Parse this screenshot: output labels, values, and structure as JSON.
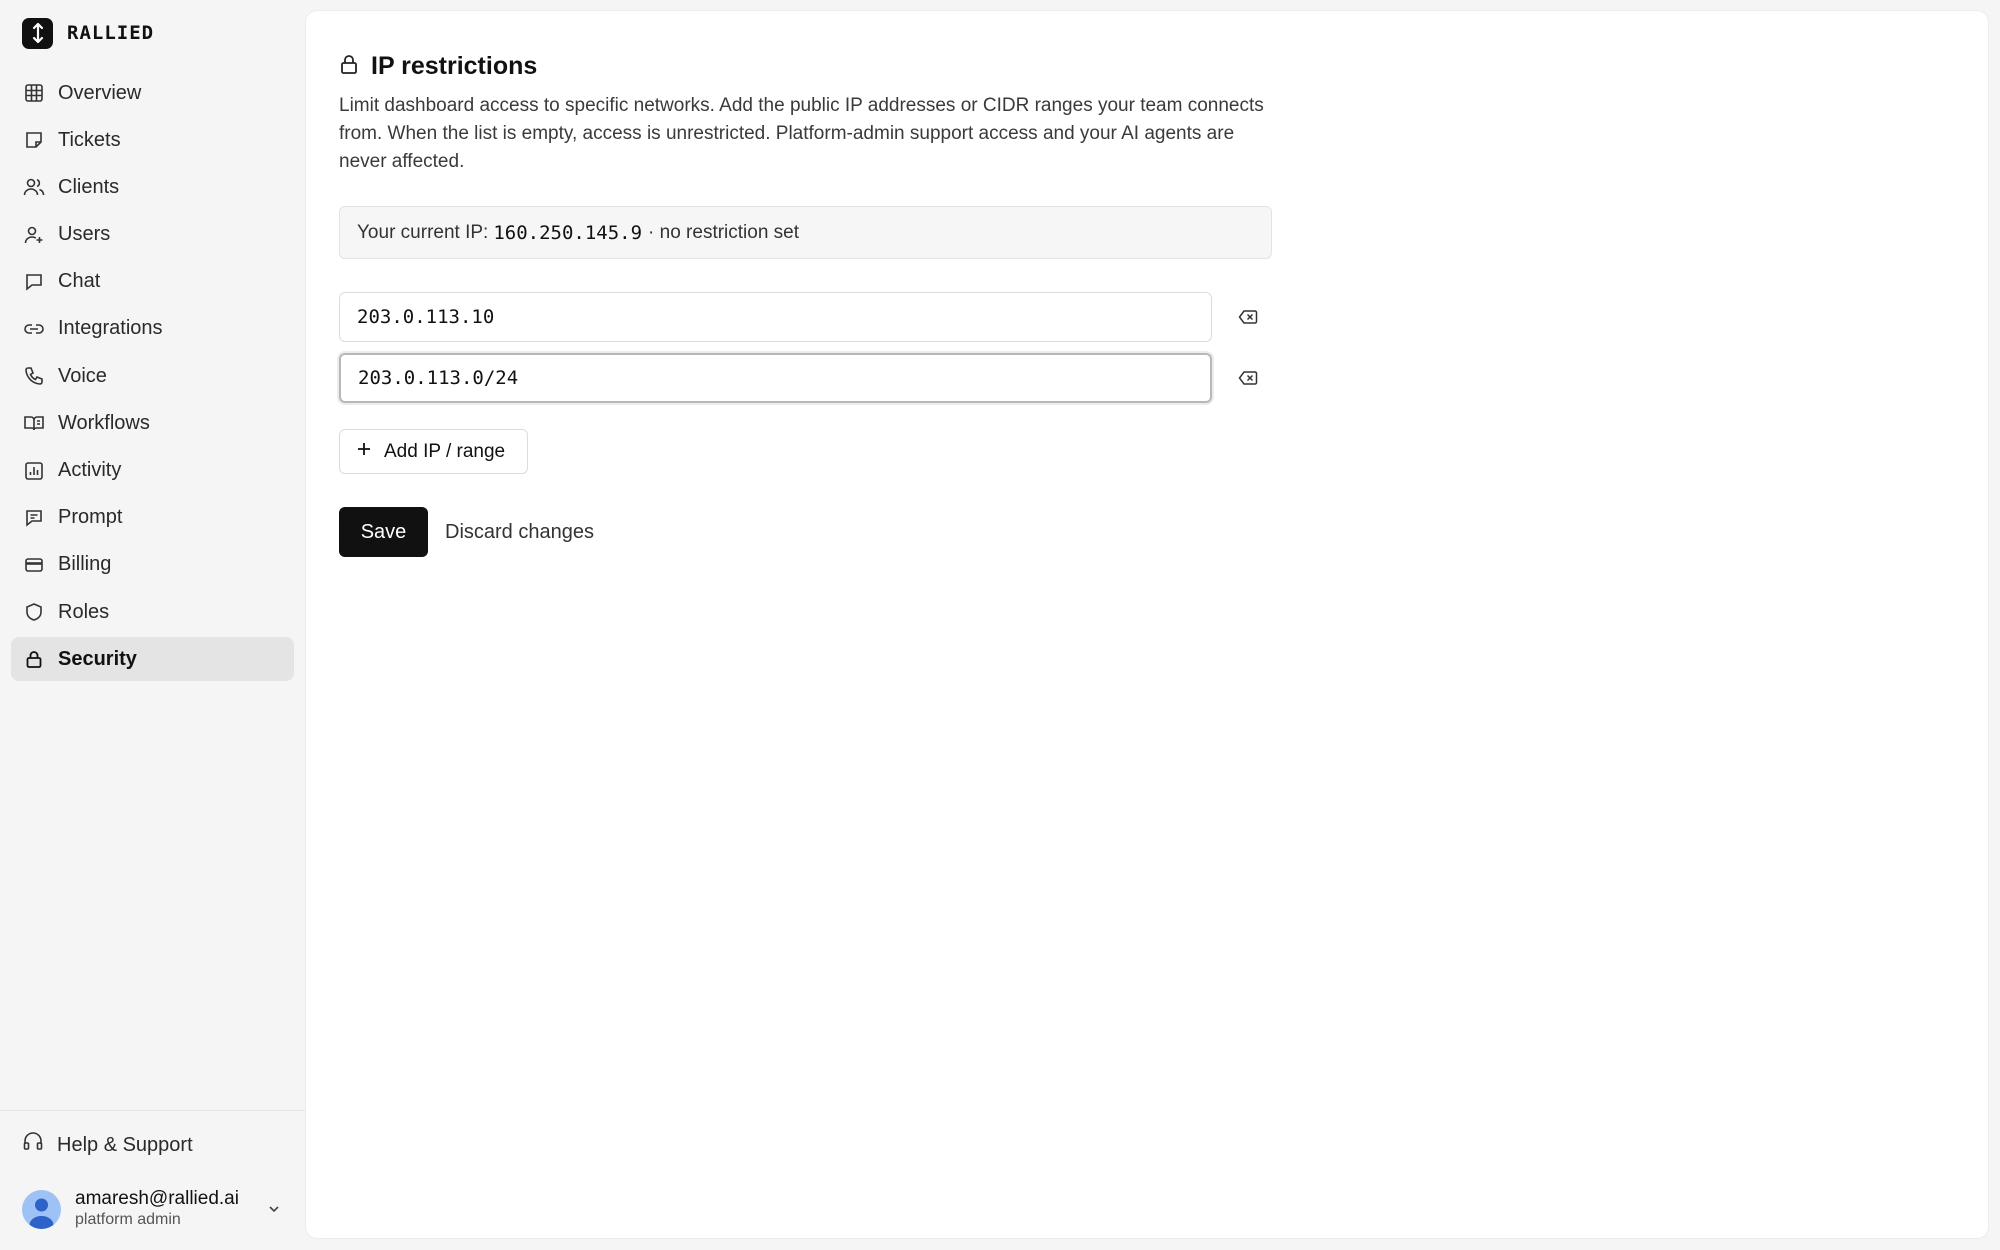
{
  "brand": {
    "name": "RALLIED"
  },
  "sidebar": {
    "items": [
      {
        "label": "Overview",
        "icon": "grid-icon"
      },
      {
        "label": "Tickets",
        "icon": "ticket-icon"
      },
      {
        "label": "Clients",
        "icon": "users-icon"
      },
      {
        "label": "Users",
        "icon": "user-plus-icon"
      },
      {
        "label": "Chat",
        "icon": "chat-icon"
      },
      {
        "label": "Integrations",
        "icon": "link-icon"
      },
      {
        "label": "Voice",
        "icon": "phone-icon"
      },
      {
        "label": "Workflows",
        "icon": "book-icon"
      },
      {
        "label": "Activity",
        "icon": "chart-icon"
      },
      {
        "label": "Prompt",
        "icon": "message-icon"
      },
      {
        "label": "Billing",
        "icon": "card-icon"
      },
      {
        "label": "Roles",
        "icon": "shield-icon"
      },
      {
        "label": "Security",
        "icon": "lock-icon",
        "active": true
      }
    ],
    "help_label": "Help & Support",
    "user": {
      "email": "amaresh@rallied.ai",
      "role": "platform admin"
    }
  },
  "page": {
    "title": "IP restrictions",
    "description": "Limit dashboard access to specific networks. Add the public IP addresses or CIDR ranges your team connects from. When the list is empty, access is unrestricted. Platform-admin support access and your AI agents are never affected.",
    "current_ip_label": "Your current IP:",
    "current_ip": "160.250.145.9",
    "current_ip_status": "· no restriction set",
    "ip_entries": [
      "203.0.113.10",
      "203.0.113.0/24"
    ],
    "add_label": "Add IP / range",
    "save_label": "Save",
    "discard_label": "Discard changes"
  },
  "colors": {
    "accent": "#111111",
    "active_nav": "#e4e4e4",
    "avatar": "#9ec2f5"
  }
}
